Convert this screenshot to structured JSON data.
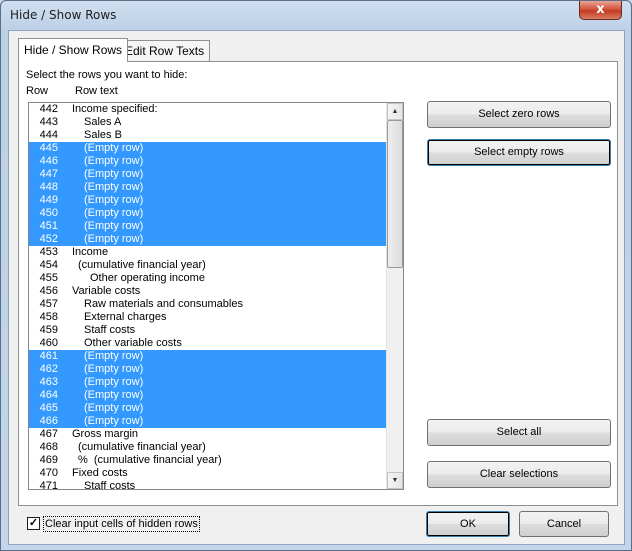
{
  "window": {
    "title": "Hide / Show Rows",
    "close_glyph": "x"
  },
  "tabs": [
    {
      "label": "Hide / Show Rows"
    },
    {
      "label": "Edit Row Texts"
    }
  ],
  "panel": {
    "instruction": "Select the rows you want to hide:",
    "col_row": "Row",
    "col_text": "Row text"
  },
  "rows": [
    {
      "num": "442",
      "text": "Income specified:",
      "indent": 0,
      "selected": false
    },
    {
      "num": "443",
      "text": "Sales A",
      "indent": 2,
      "selected": false
    },
    {
      "num": "444",
      "text": "Sales B",
      "indent": 2,
      "selected": false
    },
    {
      "num": "445",
      "text": "(Empty row)",
      "indent": 2,
      "selected": true
    },
    {
      "num": "446",
      "text": "(Empty row)",
      "indent": 2,
      "selected": true
    },
    {
      "num": "447",
      "text": "(Empty row)",
      "indent": 2,
      "selected": true
    },
    {
      "num": "448",
      "text": "(Empty row)",
      "indent": 2,
      "selected": true
    },
    {
      "num": "449",
      "text": "(Empty row)",
      "indent": 2,
      "selected": true
    },
    {
      "num": "450",
      "text": "(Empty row)",
      "indent": 2,
      "selected": true
    },
    {
      "num": "451",
      "text": "(Empty row)",
      "indent": 2,
      "selected": true
    },
    {
      "num": "452",
      "text": "(Empty row)",
      "indent": 2,
      "selected": true
    },
    {
      "num": "453",
      "text": "Income",
      "indent": 0,
      "selected": false
    },
    {
      "num": "454",
      "text": "(cumulative financial year)",
      "indent": 1,
      "selected": false
    },
    {
      "num": "455",
      "text": "Other operating income",
      "indent": 3,
      "selected": false
    },
    {
      "num": "456",
      "text": "Variable costs",
      "indent": 0,
      "selected": false
    },
    {
      "num": "457",
      "text": "Raw materials and consumables",
      "indent": 2,
      "selected": false
    },
    {
      "num": "458",
      "text": "External charges",
      "indent": 2,
      "selected": false
    },
    {
      "num": "459",
      "text": "Staff costs",
      "indent": 2,
      "selected": false
    },
    {
      "num": "460",
      "text": "Other variable costs",
      "indent": 2,
      "selected": false
    },
    {
      "num": "461",
      "text": "(Empty row)",
      "indent": 2,
      "selected": true
    },
    {
      "num": "462",
      "text": "(Empty row)",
      "indent": 2,
      "selected": true
    },
    {
      "num": "463",
      "text": "(Empty row)",
      "indent": 2,
      "selected": true
    },
    {
      "num": "464",
      "text": "(Empty row)",
      "indent": 2,
      "selected": true
    },
    {
      "num": "465",
      "text": "(Empty row)",
      "indent": 2,
      "selected": true
    },
    {
      "num": "466",
      "text": "(Empty row)",
      "indent": 2,
      "selected": true
    },
    {
      "num": "467",
      "text": "Gross margin",
      "indent": 0,
      "selected": false
    },
    {
      "num": "468",
      "text": "(cumulative financial year)",
      "indent": 1,
      "selected": false
    },
    {
      "num": "469",
      "text": "%  (cumulative financial year)",
      "indent": 1,
      "selected": false
    },
    {
      "num": "470",
      "text": "Fixed costs",
      "indent": 0,
      "selected": false
    },
    {
      "num": "471",
      "text": "Staff costs",
      "indent": 2,
      "selected": false
    }
  ],
  "buttons": {
    "select_zero": "Select zero rows",
    "select_empty": "Select empty rows",
    "select_all": "Select all",
    "clear_selections": "Clear selections",
    "ok": "OK",
    "cancel": "Cancel"
  },
  "checkbox": {
    "label": "Clear input cells of hidden rows",
    "checked": true,
    "check_glyph": "✓"
  },
  "scrollbar": {
    "up_glyph": "▲",
    "down_glyph": "▼"
  },
  "colors": {
    "selection": "#3399ff",
    "selection_text": "#ffffff"
  }
}
